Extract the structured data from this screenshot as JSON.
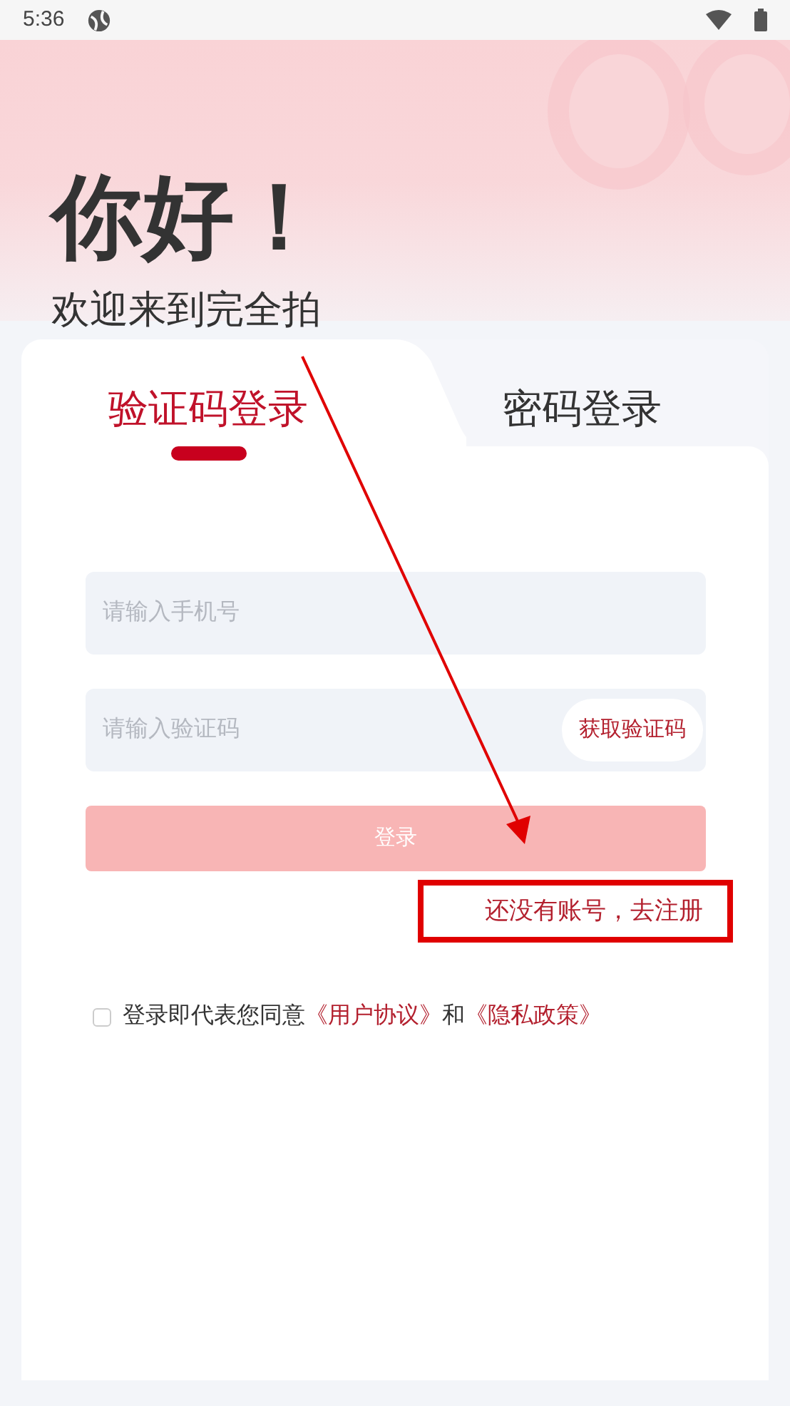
{
  "status_bar": {
    "time": "5:36"
  },
  "header": {
    "greeting": "你好！",
    "subtitle": "欢迎来到完全拍"
  },
  "tabs": [
    {
      "label": "验证码登录",
      "selected": true
    },
    {
      "label": "密码登录",
      "selected": false
    }
  ],
  "form": {
    "phone": {
      "placeholder": "请输入手机号"
    },
    "code": {
      "placeholder": "请输入验证码"
    },
    "get_code_button": "获取验证码",
    "login_button": {
      "label": "登录",
      "disabled": true
    },
    "register_link": "还没有账号，去注册"
  },
  "agreement": {
    "checked": false,
    "text": "登录即代表您同意",
    "links": [
      "《用户协议》",
      "《隐私政策》"
    ],
    "conjunction": "和"
  }
}
